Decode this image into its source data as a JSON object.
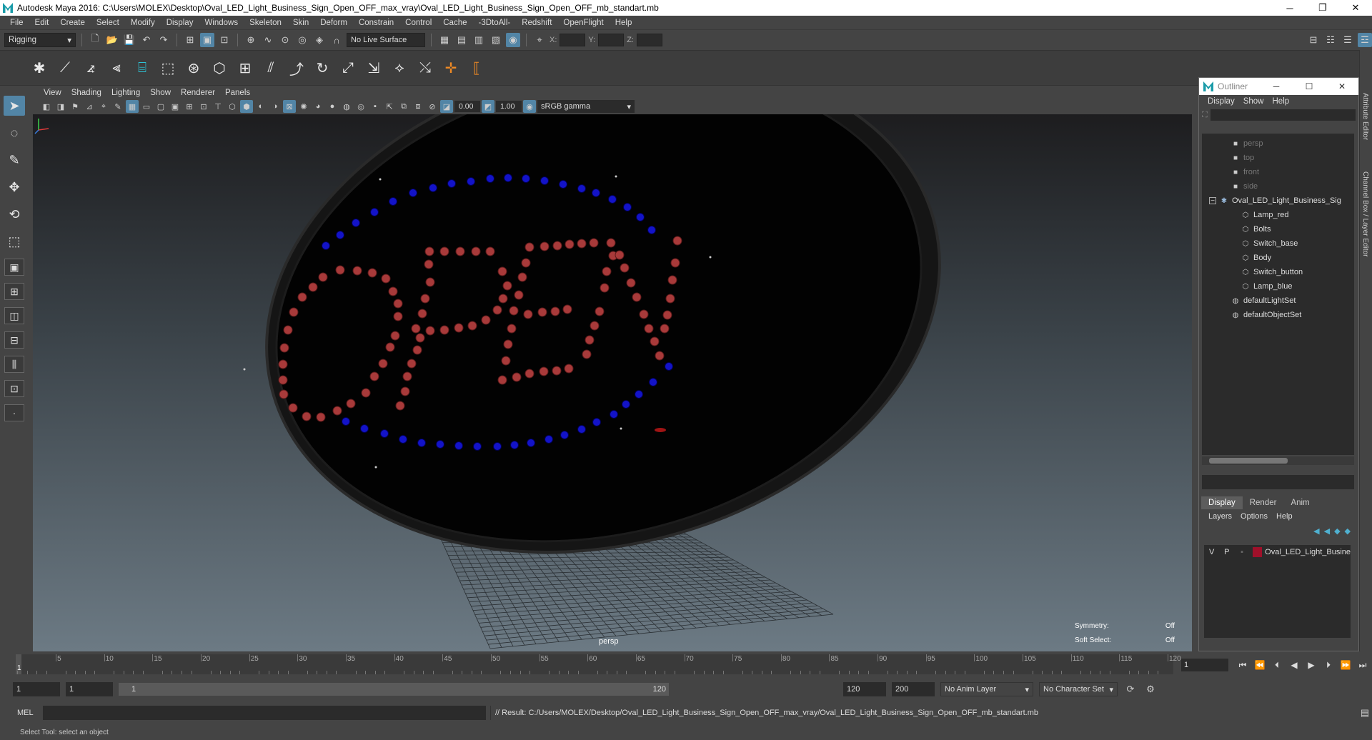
{
  "window": {
    "title": "Autodesk Maya 2016: C:\\Users\\MOLEX\\Desktop\\Oval_LED_Light_Business_Sign_Open_OFF_max_vray\\Oval_LED_Light_Business_Sign_Open_OFF_mb_standart.mb"
  },
  "menubar": [
    "File",
    "Edit",
    "Create",
    "Select",
    "Modify",
    "Display",
    "Windows",
    "Skeleton",
    "Skin",
    "Deform",
    "Constrain",
    "Control",
    "Cache",
    "-3DtoAll-",
    "Redshift",
    "OpenFlight",
    "Help"
  ],
  "statusline": {
    "mode": "Rigging",
    "live_surface": "No Live Surface",
    "x_label": "X:",
    "y_label": "Y:",
    "z_label": "Z:"
  },
  "viewport_menu": [
    "View",
    "Shading",
    "Lighting",
    "Show",
    "Renderer",
    "Panels"
  ],
  "viewport_tools": {
    "exposure": "0.00",
    "gamma_value": "1.00",
    "color_space": "sRGB gamma"
  },
  "viewport": {
    "camera": "persp",
    "symmetry_label": "Symmetry:",
    "symmetry_value": "Off",
    "soft_select_label": "Soft Select:",
    "soft_select_value": "Off"
  },
  "outliner": {
    "title": "Outliner",
    "menu": [
      "Display",
      "Show",
      "Help"
    ],
    "cameras": [
      "persp",
      "top",
      "front",
      "side"
    ],
    "group": "Oval_LED_Light_Business_Sig",
    "children": [
      "Lamp_red",
      "Bolts",
      "Switch_base",
      "Body",
      "Switch_button",
      "Lamp_blue"
    ],
    "sets": [
      "defaultLightSet",
      "defaultObjectSet"
    ]
  },
  "side_tabs": {
    "attribute_editor": "Attribute Editor",
    "channel_box": "Channel Box / Layer Editor"
  },
  "layer_editor": {
    "tabs": [
      "Display",
      "Render",
      "Anim"
    ],
    "menu": [
      "Layers",
      "Options",
      "Help"
    ],
    "layer": {
      "v": "V",
      "p": "P",
      "name": "Oval_LED_Light_Busine",
      "color": "#a0102a"
    }
  },
  "timeline": {
    "ticks": [
      "5",
      "10",
      "15",
      "20",
      "25",
      "30",
      "35",
      "40",
      "45",
      "50",
      "55",
      "60",
      "65",
      "70",
      "75",
      "80",
      "85",
      "90",
      "95",
      "100",
      "105",
      "110",
      "115",
      "120"
    ],
    "start_tick": "1",
    "current_frame": "1"
  },
  "range": {
    "start": "1",
    "playback_start": "1",
    "slider_start": "1",
    "slider_end": "120",
    "playback_end": "120",
    "end": "200",
    "anim_layer": "No Anim Layer",
    "char_set": "No Character Set"
  },
  "command": {
    "mel": "MEL",
    "result": "// Result: C:/Users/MOLEX/Desktop/Oval_LED_Light_Business_Sign_Open_OFF_max_vray/Oval_LED_Light_Business_Sign_Open_OFF_mb_standart.mb"
  },
  "help_line": "Select Tool: select an object",
  "colors": {
    "accent": "#5285a6",
    "led_red": "#a83a3a",
    "led_blue": "#1313c8",
    "teal": "#1a9ba8"
  }
}
